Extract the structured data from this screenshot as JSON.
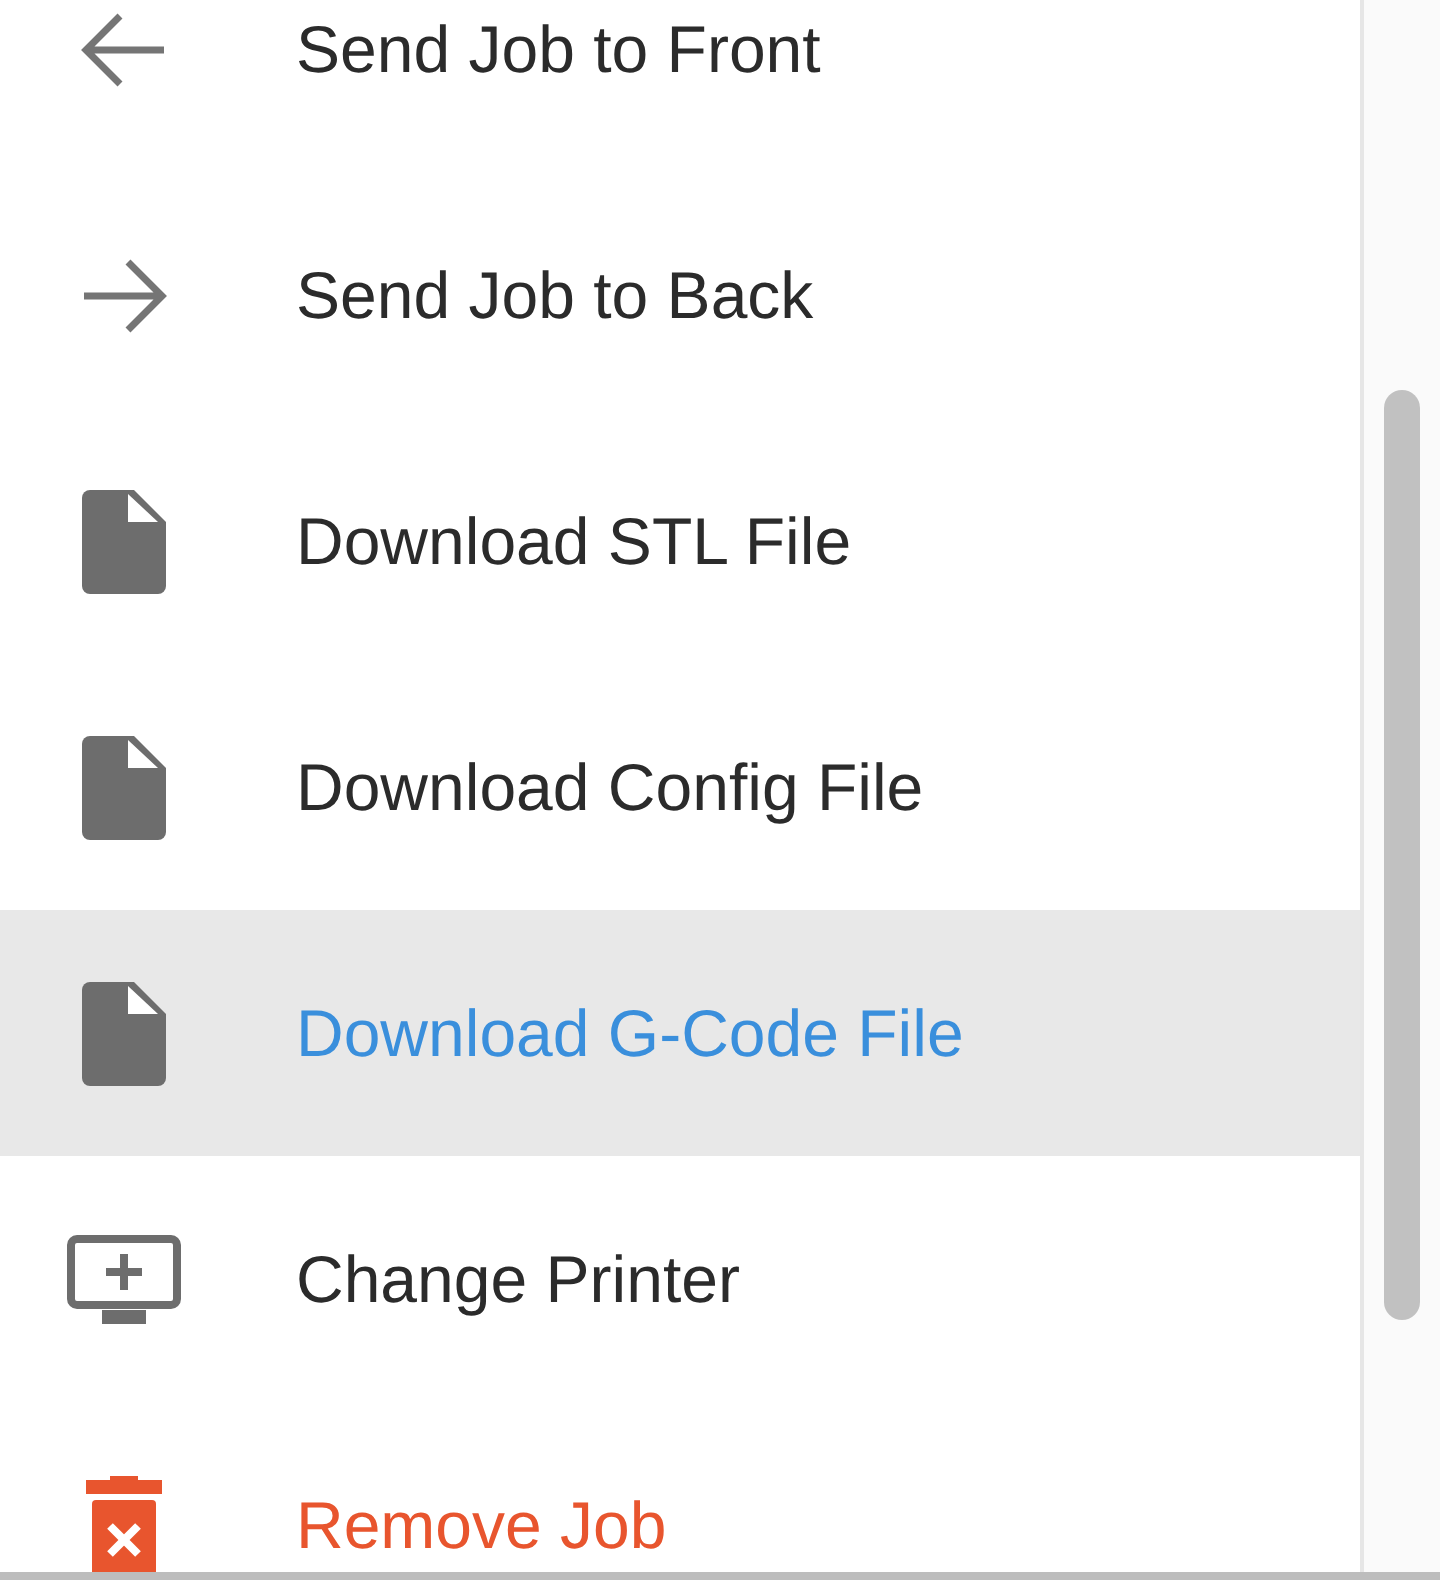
{
  "menu": {
    "items": [
      {
        "kind": "arrow-left",
        "label": "Send Job to Front",
        "selected": false,
        "danger": false
      },
      {
        "kind": "arrow-right",
        "label": "Send Job to Back",
        "selected": false,
        "danger": false
      },
      {
        "kind": "file",
        "label": "Download STL File",
        "selected": false,
        "danger": false
      },
      {
        "kind": "file",
        "label": "Download Config File",
        "selected": false,
        "danger": false
      },
      {
        "kind": "file",
        "label": "Download G-Code File",
        "selected": true,
        "danger": false
      },
      {
        "kind": "monitor-plus",
        "label": "Change Printer",
        "selected": false,
        "danger": false
      },
      {
        "kind": "trash",
        "label": "Remove Job",
        "selected": false,
        "danger": true
      }
    ]
  }
}
